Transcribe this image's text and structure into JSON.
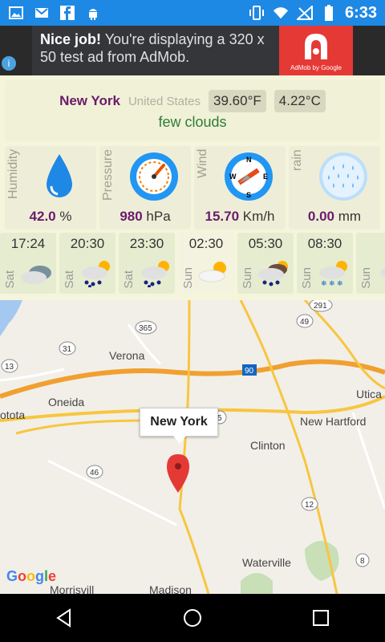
{
  "status_bar": {
    "time": "6:33",
    "left_icons": [
      "image-icon",
      "gmail-icon",
      "facebook-icon",
      "android-icon"
    ],
    "right_icons": [
      "vibrate-icon",
      "wifi-icon",
      "no-signal-icon",
      "battery-icon"
    ]
  },
  "ad": {
    "headline": "Nice job!",
    "body": " You're displaying a 320 x 50 test ad from AdMob.",
    "logo_text": "AdMob by Google",
    "info_icon": "info-icon"
  },
  "location": {
    "city": "New York",
    "country": "United States",
    "temp_f": "39.60°F",
    "temp_c": "4.22°C",
    "description": "few clouds"
  },
  "stats": [
    {
      "label": "Humidity",
      "value": "42.0",
      "unit": " %",
      "icon": "water-drop-icon"
    },
    {
      "label": "Pressure",
      "value": "980",
      "unit": " hPa",
      "icon": "pressure-gauge-icon"
    },
    {
      "label": "Wind",
      "value": "15.70",
      "unit": " Km/h",
      "icon": "compass-icon"
    },
    {
      "label": "rain",
      "value": "0.00",
      "unit": " mm",
      "icon": "rain-icon"
    }
  ],
  "forecast": [
    {
      "time": "17:24",
      "day": "Sat",
      "icon": "cloudy-icon"
    },
    {
      "time": "20:30",
      "day": "Sat",
      "icon": "partly-cloudy-rain-icon"
    },
    {
      "time": "23:30",
      "day": "Sat",
      "icon": "partly-cloudy-rain-icon"
    },
    {
      "time": "02:30",
      "day": "Sun",
      "icon": "partly-sunny-icon"
    },
    {
      "time": "05:30",
      "day": "Sun",
      "icon": "partly-cloudy-rain-icon"
    },
    {
      "time": "08:30",
      "day": "Sun",
      "icon": "snow-cloud-icon"
    },
    {
      "time": "",
      "day": "Sun",
      "icon": "cloudy-icon"
    }
  ],
  "map": {
    "marker_label": "New York",
    "places": [
      "Verona",
      "Oneida",
      "Utica",
      "New Hartford",
      "Clinton",
      "Waterville",
      "otota",
      "Morrisvill",
      "Madison"
    ],
    "route_shields": [
      "291",
      "49",
      "365",
      "31",
      "13",
      "90",
      "46",
      "5",
      "12",
      "8"
    ],
    "google_logo": "Google"
  },
  "nav": {
    "back": "back-icon",
    "home": "home-icon",
    "recents": "recents-icon"
  },
  "colors": {
    "status_bar": "#1e88e5",
    "city_purple": "#6a1b6a",
    "description_green": "#2e7d32",
    "ad_red": "#e53935"
  }
}
